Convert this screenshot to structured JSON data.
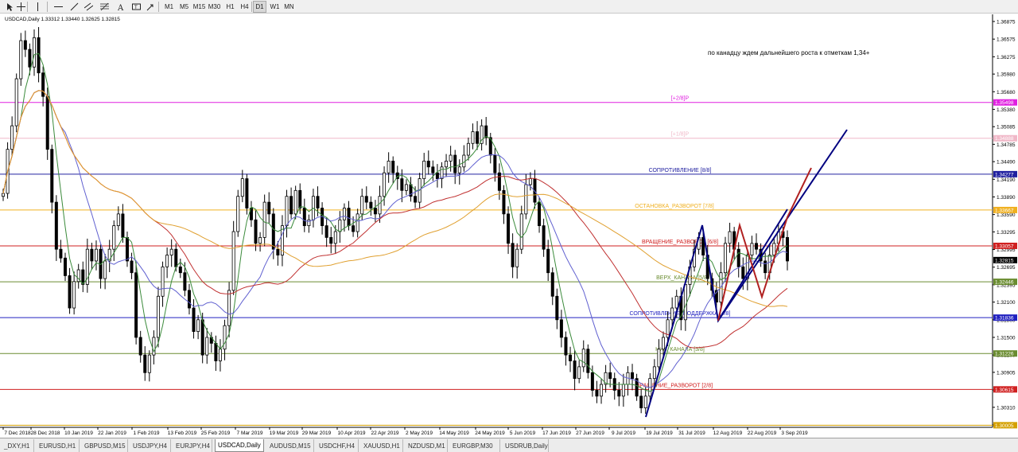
{
  "toolbar": {
    "tools": [
      {
        "icon": "cursor-arrow-icon"
      },
      {
        "icon": "crosshair-icon"
      },
      {
        "icon": "vertical-line-icon"
      },
      {
        "icon": "horizontal-line-icon"
      },
      {
        "icon": "trendline-icon"
      },
      {
        "icon": "equidistant-channel-icon"
      },
      {
        "icon": "fibonacci-retracement-icon"
      },
      {
        "icon": "text-icon"
      },
      {
        "icon": "text-label-icon"
      },
      {
        "icon": "arrow-marker-icon"
      }
    ],
    "timeframes": [
      "M1",
      "M5",
      "M15",
      "M30",
      "H1",
      "H4",
      "D1",
      "W1",
      "MN"
    ],
    "active_timeframe": "D1"
  },
  "chart": {
    "header": "USDCAD,Daily  1.33312 1.33440 1.32625 1.32815",
    "comment": "по канадцу ждем дальнейшего роста к отметкам 1,34+",
    "price_axis": [
      "1.36875",
      "1.36575",
      "1.36275",
      "1.35980",
      "1.35680",
      "1.35380",
      "1.35085",
      "1.34785",
      "1.34490",
      "1.34190",
      "1.33890",
      "1.33590",
      "1.33295",
      "1.32995",
      "1.32695",
      "1.32395",
      "1.32100",
      "1.31800",
      "1.31500",
      "1.31200",
      "1.30905",
      "1.30605",
      "1.30310",
      "1.30010"
    ],
    "time_axis": [
      "7 Dec 2018",
      "28 Dec 2018",
      "10 Jan 2019",
      "22 Jan 2019",
      "1 Feb 2019",
      "13 Feb 2019",
      "25 Feb 2019",
      "7 Mar 2019",
      "19 Mar 2019",
      "29 Mar 2019",
      "10 Apr 2019",
      "22 Apr 2019",
      "2 May 2019",
      "14 May 2019",
      "24 May 2019",
      "5 Jun 2019",
      "17 Jun 2019",
      "27 Jun 2019",
      "9 Jul 2019",
      "19 Jul 2019",
      "31 Jul 2019",
      "12 Aug 2019",
      "22 Aug 2019",
      "3 Sep 2019"
    ],
    "levels": [
      {
        "label": "[+2/8]P",
        "price": "1.35498",
        "color": "#e020e0"
      },
      {
        "label": "[+1/8]P",
        "price": "1.34888",
        "color": "#f0b8c8"
      },
      {
        "label": "СОПРОТИВЛЕНИЕ [8/8]",
        "price": "1.34277",
        "color": "#2020a0"
      },
      {
        "label": "ОСТАНОВКА_РАЗВОРОТ [7/8]",
        "price": "1.33667",
        "color": "#f0b020"
      },
      {
        "label": "ВРАЩЕНИЕ_РАЗВОРОТ [6/8]",
        "price": "1.33057",
        "color": "#d02020"
      },
      {
        "label": "ВЕРХ_КАНАЛА [5/8]",
        "price": "1.32446",
        "color": "#6a8c30"
      },
      {
        "label": "СОПРОТИВЛЕНИЕ_ПОДДЕРЖКА [4/8]",
        "price": "1.31836",
        "color": "#2020c0"
      },
      {
        "label": "НИЗ_КАНАЛА [3/8]",
        "price": "1.31226",
        "color": "#6a8c30"
      },
      {
        "label": "ВРАЩЕНИЕ_РАЗВОРОТ [2/8]",
        "price": "1.30615",
        "color": "#d02020"
      },
      {
        "label": "",
        "price": "1.30005",
        "color": "#d4a000"
      }
    ],
    "current_price": "1.32815"
  },
  "symbol_tabs": [
    "_DXY,H1",
    "EURUSD,H1",
    "GBPUSD,M15",
    "USDJPY,H4",
    "EURJPY,H4",
    "USDCAD,Daily",
    "AUDUSD,M15",
    "USDCHF,H4",
    "XAUUSD,H1",
    "NZDUSD,M1",
    "EURGBP,M30",
    "USDRUB,Daily"
  ],
  "active_tab": "USDCAD,Daily"
}
